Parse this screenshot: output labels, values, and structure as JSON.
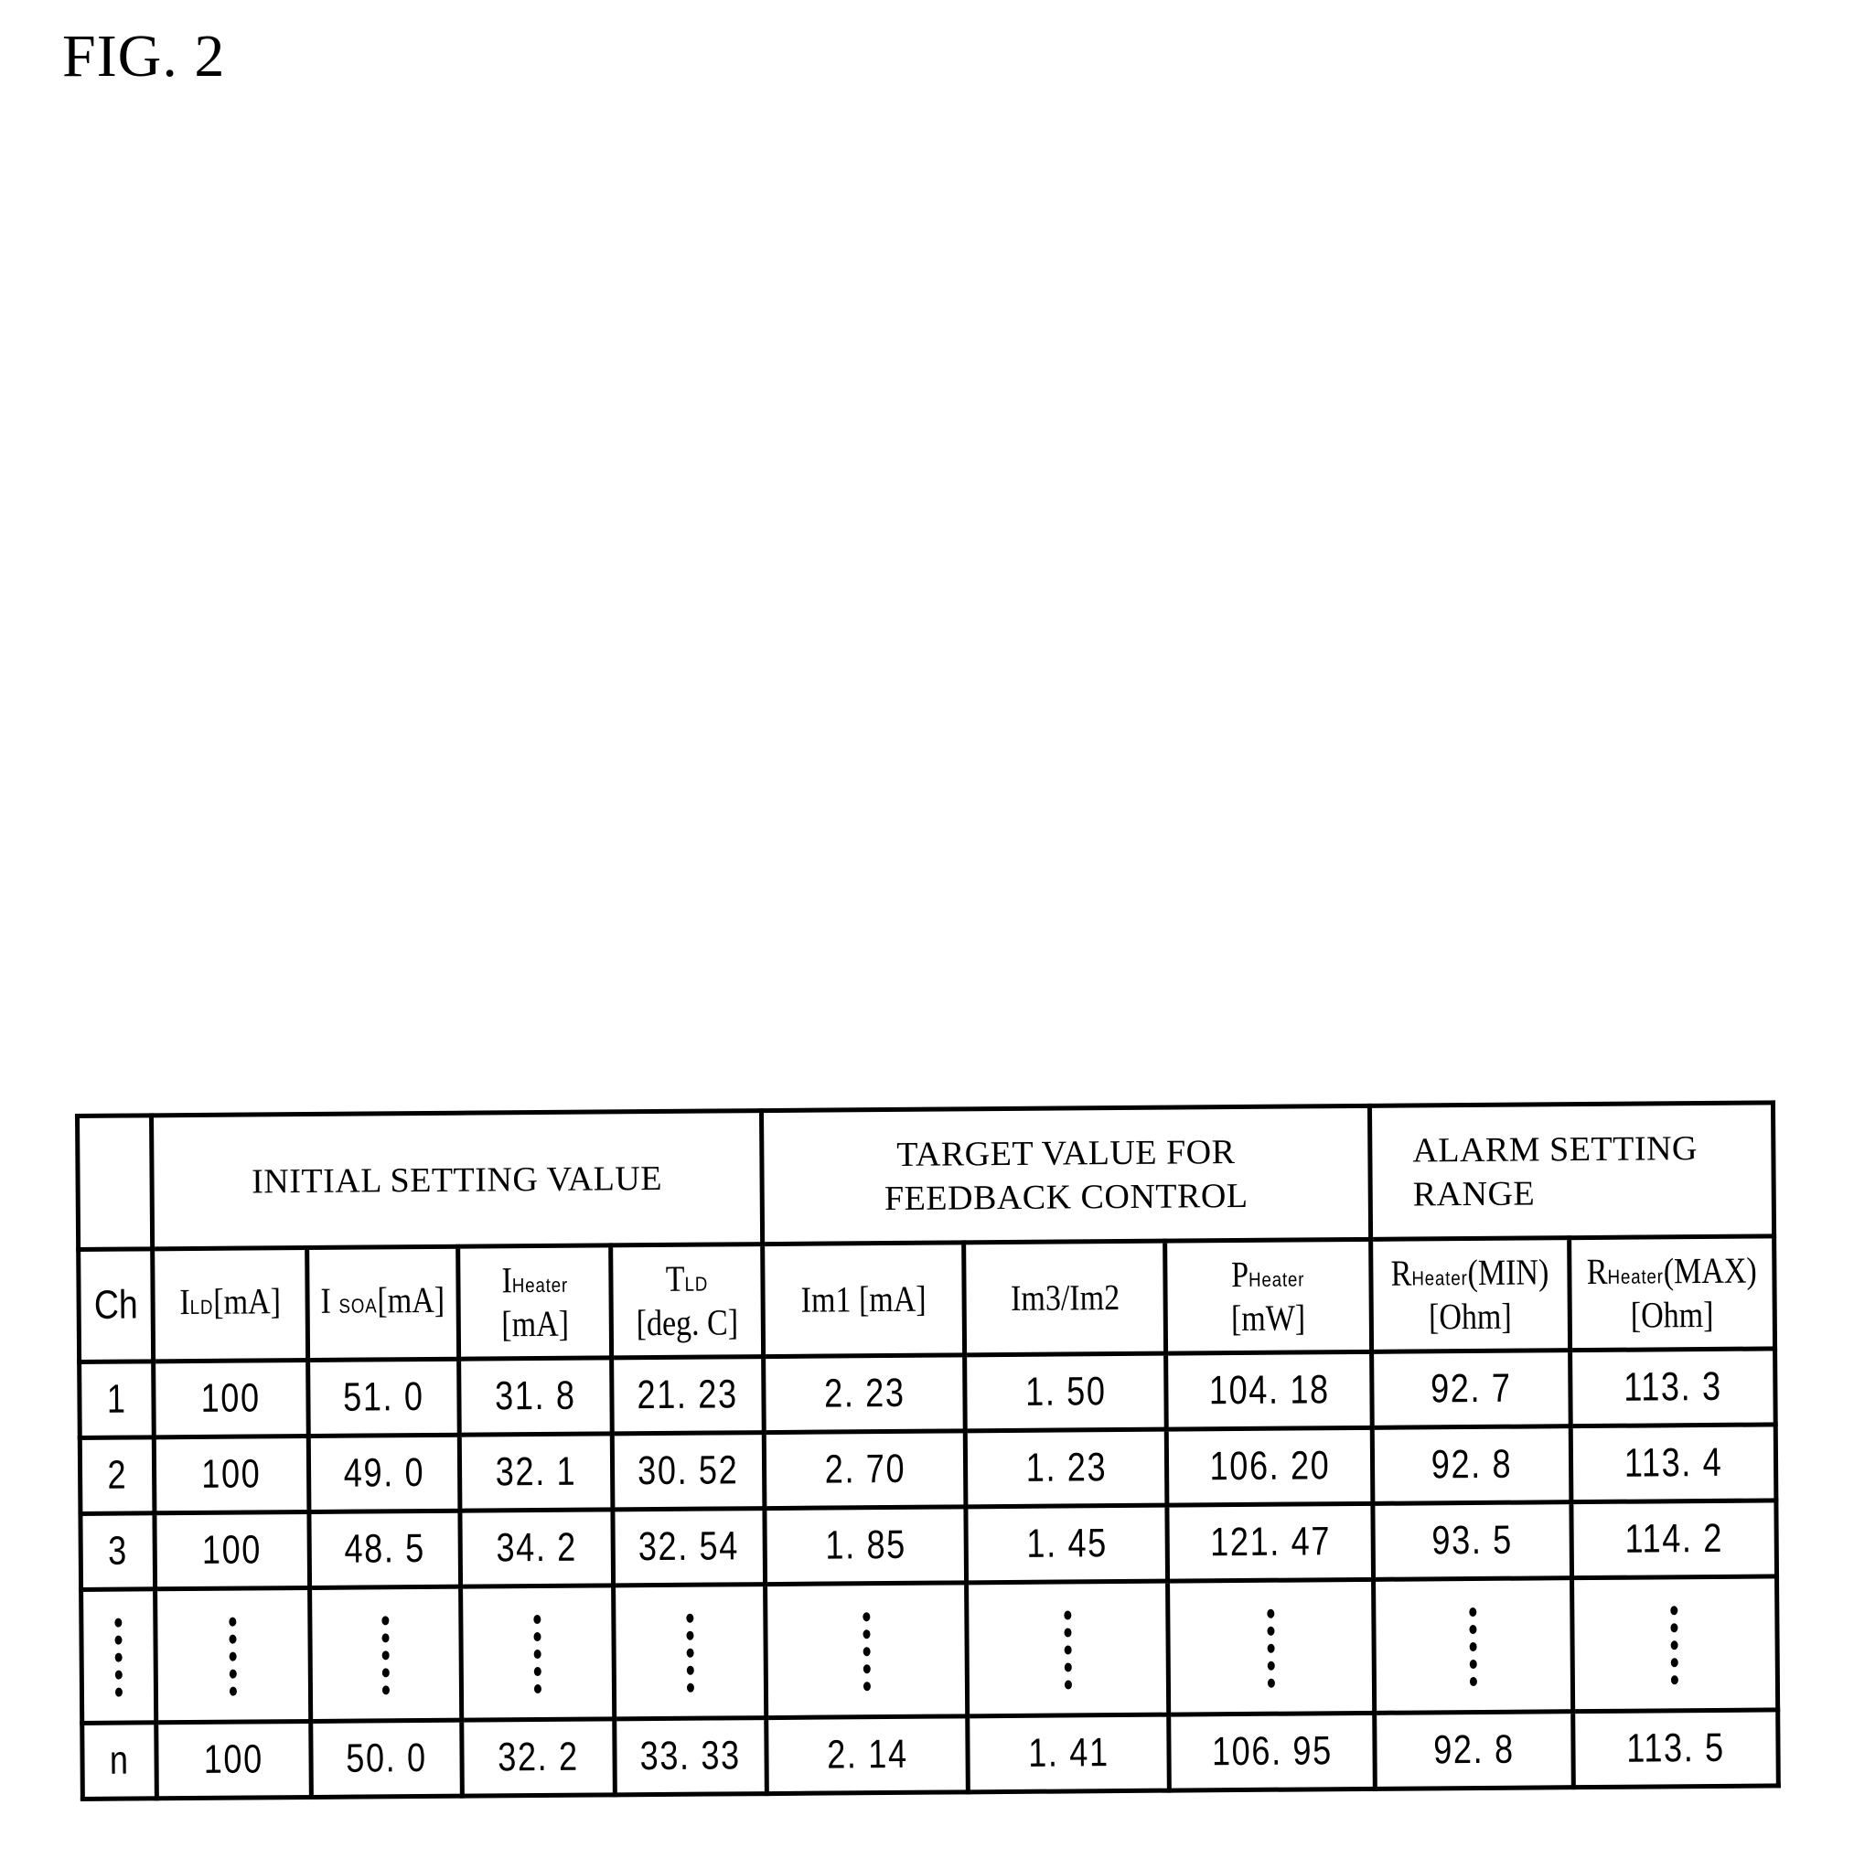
{
  "figure": {
    "title": "FIG. 2"
  },
  "table": {
    "groups": {
      "initial": "INITIAL SETTING VALUE",
      "target_line1": "TARGET VALUE FOR",
      "target_line2": "FEEDBACK CONTROL",
      "alarm_line1": "ALARM SETTING",
      "alarm_line2": "RANGE"
    },
    "columns": {
      "ch": "Ch",
      "ild": {
        "main": "I",
        "sub": "LD",
        "unit": "[mA]"
      },
      "isoa": {
        "main": "I ",
        "sub": "SOA",
        "unit": "[mA]"
      },
      "iheater": {
        "main": "I",
        "sub": "Heater",
        "unit": "[mA]"
      },
      "tld": {
        "main": "T",
        "sub": "LD",
        "unit": "[deg. C]"
      },
      "im1": {
        "main": "Im1 [mA]"
      },
      "im3im2": {
        "main": "Im3/Im2"
      },
      "pheater": {
        "main": "P",
        "sub": "Heater",
        "unit": "[mW]"
      },
      "rmin": {
        "main": "R",
        "sub": "Heater",
        "suffix": "(MIN)",
        "unit": "[Ohm]"
      },
      "rmax": {
        "main": "R",
        "sub": "Heater",
        "suffix": "(MAX)",
        "unit": "[Ohm]"
      }
    },
    "rows": [
      {
        "ch": "1",
        "ild": "100",
        "isoa": "51. 0",
        "iheater": "31. 8",
        "tld": "21. 23",
        "im1": "2. 23",
        "im3im2": "1. 50",
        "pheater": "104. 18",
        "rmin": "92. 7",
        "rmax": "113. 3"
      },
      {
        "ch": "2",
        "ild": "100",
        "isoa": "49. 0",
        "iheater": "32. 1",
        "tld": "30. 52",
        "im1": "2. 70",
        "im3im2": "1. 23",
        "pheater": "106. 20",
        "rmin": "92. 8",
        "rmax": "113. 4"
      },
      {
        "ch": "3",
        "ild": "100",
        "isoa": "48. 5",
        "iheater": "34. 2",
        "tld": "32. 54",
        "im1": "1. 85",
        "im3im2": "1. 45",
        "pheater": "121. 47",
        "rmin": "93. 5",
        "rmax": "114. 2"
      },
      {
        "ch": "n",
        "ild": "100",
        "isoa": "50. 0",
        "iheater": "32. 2",
        "tld": "33. 33",
        "im1": "2. 14",
        "im3im2": "1. 41",
        "pheater": "106. 95",
        "rmin": "92. 8",
        "rmax": "113. 5"
      }
    ],
    "ellipsis_row": "vertical-ellipsis"
  }
}
